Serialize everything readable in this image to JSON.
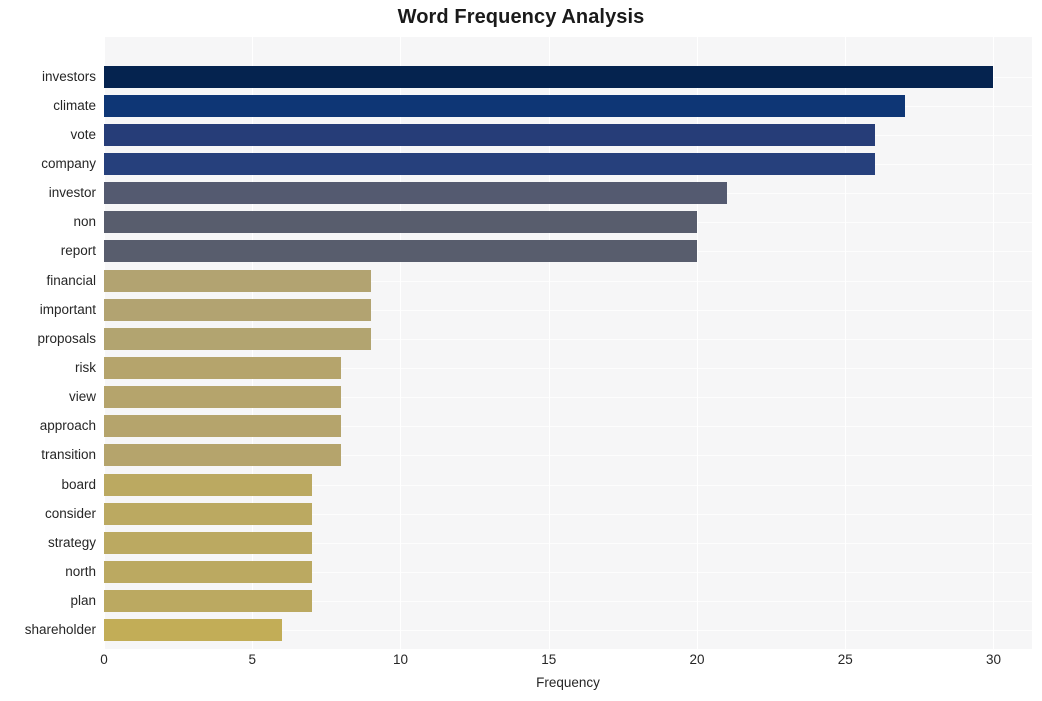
{
  "chart_data": {
    "type": "bar",
    "orientation": "horizontal",
    "title": "Word Frequency Analysis",
    "xlabel": "Frequency",
    "ylabel": "",
    "xlim": [
      0,
      31.3
    ],
    "xticks": [
      0,
      5,
      10,
      15,
      20,
      25,
      30
    ],
    "xticklabels": [
      "0",
      "5",
      "10",
      "15",
      "20",
      "25",
      "30"
    ],
    "grid": "vertical-and-horizontal-white-on-light-gray",
    "legend": "none",
    "categories": [
      "investors",
      "climate",
      "vote",
      "company",
      "investor",
      "non",
      "report",
      "financial",
      "important",
      "proposals",
      "risk",
      "view",
      "approach",
      "transition",
      "board",
      "consider",
      "strategy",
      "north",
      "plan",
      "shareholder"
    ],
    "values": [
      30,
      27,
      26,
      26,
      21,
      20,
      20,
      9,
      9,
      9,
      8,
      8,
      8,
      8,
      7,
      7,
      7,
      7,
      7,
      6
    ],
    "bar_colors": [
      "#05234f",
      "#0e3675",
      "#263d78",
      "#26407c",
      "#545a70",
      "#585d6d",
      "#585d6d",
      "#b2a371",
      "#b2a371",
      "#b2a470",
      "#b5a46c",
      "#b5a46c",
      "#b5a46c",
      "#b5a46c",
      "#bba961",
      "#bba961",
      "#bba961",
      "#bba961",
      "#bba961",
      "#c2ad57"
    ]
  },
  "style": {
    "figure_background": "#ffffff",
    "plot_background": "#f6f6f7",
    "grid_color": "#ffffff",
    "text_color": "#262626",
    "title_color": "#1a1a1a"
  }
}
